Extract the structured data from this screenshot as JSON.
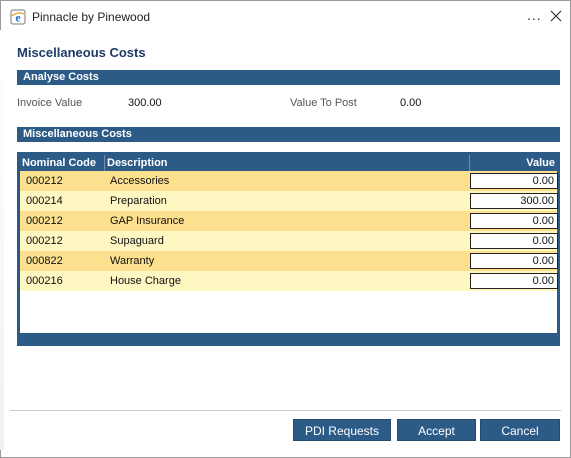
{
  "window": {
    "title": "Pinnacle by Pinewood",
    "more_glyph": "...",
    "close_icon": "close-icon",
    "app_icon": "ie-icon"
  },
  "page_title": "Miscellaneous Costs",
  "analyse": {
    "header": "Analyse Costs",
    "invoice_label": "Invoice Value",
    "invoice_value": "300.00",
    "post_label": "Value To Post",
    "post_value": "0.00"
  },
  "costs": {
    "header": "Miscellaneous Costs",
    "columns": [
      "Nominal Code",
      "Description",
      "Value"
    ],
    "rows": [
      {
        "code": "000212",
        "description": "Accessories",
        "value": "0.00"
      },
      {
        "code": "000214",
        "description": "Preparation",
        "value": "300.00"
      },
      {
        "code": "000212",
        "description": "GAP Insurance",
        "value": "0.00"
      },
      {
        "code": "000212",
        "description": "Supaguard",
        "value": "0.00"
      },
      {
        "code": "000822",
        "description": "Warranty",
        "value": "0.00"
      },
      {
        "code": "000216",
        "description": "House Charge",
        "value": "0.00"
      }
    ]
  },
  "buttons": {
    "pdi": "PDI Requests",
    "accept": "Accept",
    "cancel": "Cancel"
  },
  "colors": {
    "header_blue": "#2c5b87",
    "row_odd": "#fde08e",
    "row_even": "#fff7c2"
  }
}
